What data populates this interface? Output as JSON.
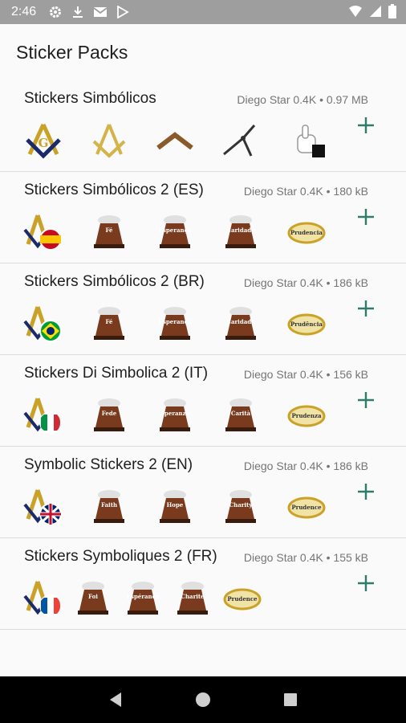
{
  "status_bar": {
    "time": "2:46",
    "left_icons": [
      "gear-icon",
      "download-icon",
      "mail-icon",
      "play-store-icon"
    ],
    "right_icons": [
      "wifi-icon",
      "signal-icon",
      "battery-icon"
    ]
  },
  "app": {
    "title": "Sticker Packs"
  },
  "packs": [
    {
      "name": "Stickers Simbólicos",
      "meta": "Diego Star 0.4K • 0.97 MB",
      "stickers": [
        "square-compass-g",
        "square-compass",
        "square",
        "compass",
        "white-glove"
      ]
    },
    {
      "name": "Stickers Simbólicos 2 (ES)",
      "meta": "Diego Star 0.4K • 180 kB",
      "stickers": [
        "compass-flag-es",
        "pedestal",
        "pedestal",
        "pedestal",
        "ring"
      ],
      "labels": [
        "",
        "Fé",
        "Esperança",
        "Caridade",
        "Prudencia"
      ]
    },
    {
      "name": "Stickers Simbólicos 2 (BR)",
      "meta": "Diego Star 0.4K • 186 kB",
      "stickers": [
        "compass-flag-br",
        "pedestal",
        "pedestal",
        "pedestal",
        "ring"
      ],
      "labels": [
        "",
        "Fé",
        "Esperança",
        "Caridade",
        "Prudência"
      ]
    },
    {
      "name": "Stickers Di Simbolica 2 (IT)",
      "meta": "Diego Star 0.4K • 156 kB",
      "stickers": [
        "compass-flag-it",
        "pedestal",
        "pedestal",
        "pedestal",
        "ring"
      ],
      "labels": [
        "",
        "Fede",
        "Speranza",
        "Carità",
        "Prudenza"
      ]
    },
    {
      "name": "Symbolic Stickers 2 (EN)",
      "meta": "Diego Star 0.4K • 186 kB",
      "stickers": [
        "compass-flag-uk",
        "pedestal",
        "pedestal",
        "pedestal",
        "ring"
      ],
      "labels": [
        "",
        "Faith",
        "Hope",
        "Charity",
        "Prudence"
      ]
    },
    {
      "name": "Stickers Symboliques 2 (FR)",
      "meta": "Diego Star 0.4K • 155 kB",
      "stickers": [
        "compass-flag-fr",
        "pedestal",
        "pedestal",
        "pedestal",
        "ring"
      ],
      "labels": [
        "",
        "Foi",
        "Espérance",
        "Charité",
        "Prudence"
      ]
    }
  ],
  "colors": {
    "accent": "#2e7d6b",
    "status_bar": "#9e9e9e",
    "divider": "#dddddd"
  },
  "navbar": {
    "icons": [
      "back-icon",
      "home-icon",
      "recents-icon"
    ]
  }
}
